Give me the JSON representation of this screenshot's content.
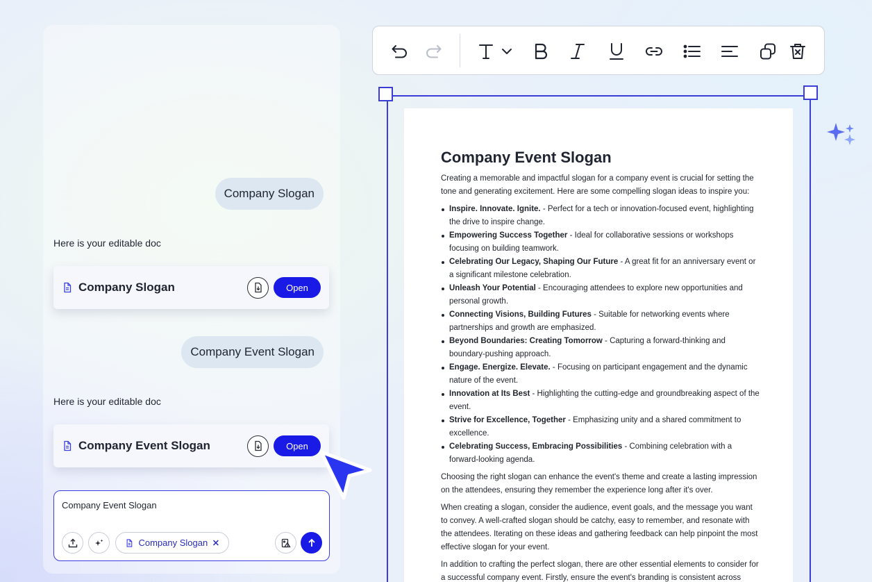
{
  "chat": {
    "messages": [
      {
        "user": "Company Slogan",
        "reply": "Here is your editable doc",
        "doc_title": "Company Slogan",
        "open_label": "Open"
      },
      {
        "user": "Company Event Slogan",
        "reply": "Here is your editable doc",
        "doc_title": "Company Event Slogan",
        "open_label": "Open"
      }
    ],
    "composer": {
      "text": "Company Event Slogan",
      "chip_label": "Company Slogan"
    }
  },
  "toolbar": {
    "icons": [
      "undo-icon",
      "redo-icon",
      "text-style-icon",
      "bold-icon",
      "italic-icon",
      "underline-icon",
      "link-icon",
      "bullet-list-icon",
      "align-icon",
      "duplicate-icon",
      "delete-icon"
    ]
  },
  "colors": {
    "accent": "#1a1ae6",
    "frame": "#3b3ed6"
  },
  "doc": {
    "heading": "Company Event Slogan",
    "intro": "Creating a memorable and impactful slogan for a company event is crucial for setting the tone and generating excitement. Here are some compelling slogan ideas to inspire you:",
    "items": [
      {
        "bold": "Inspire. Innovate. Ignite.",
        "text": " - Perfect for a tech or innovation-focused event, highlighting the drive to inspire change."
      },
      {
        "bold": "Empowering Success Together",
        "text": " - Ideal for collaborative sessions or workshops focusing on building teamwork."
      },
      {
        "bold": "Celebrating Our Legacy, Shaping Our Future",
        "text": " - A great fit for an anniversary event or a significant milestone celebration."
      },
      {
        "bold": "Unleash Your Potential",
        "text": " - Encouraging attendees to explore new opportunities and personal growth."
      },
      {
        "bold": "Connecting Visions, Building Futures",
        "text": " - Suitable for networking events where partnerships and growth are emphasized."
      },
      {
        "bold": "Beyond Boundaries: Creating Tomorrow",
        "text": " - Capturing a forward-thinking and boundary-pushing approach."
      },
      {
        "bold": "Engage. Energize. Elevate.",
        "text": " - Focusing on participant engagement and the dynamic nature of the event."
      },
      {
        "bold": "Innovation at Its Best",
        "text": " - Highlighting the cutting-edge and groundbreaking aspect of the event."
      },
      {
        "bold": "Strive for Excellence, Together",
        "text": " - Emphasizing unity and a shared commitment to excellence."
      },
      {
        "bold": "Celebrating Success, Embracing Possibilities",
        "text": " - Combining celebration with a forward-looking agenda."
      }
    ],
    "para1": "Choosing the right slogan can enhance the event's theme and create a lasting impression on the attendees, ensuring they remember the experience long after it's over.",
    "para2": "When creating a slogan, consider the audience, event goals, and the message you want to convey. A well-crafted slogan should be catchy, easy to remember, and resonate with the attendees. Iterating on these ideas and gathering feedback can help pinpoint the most effective slogan for your event.",
    "para3": "In addition to crafting the perfect slogan, there are other essential elements to consider for a successful company event. Firstly, ensure the event's branding is consistent across"
  }
}
